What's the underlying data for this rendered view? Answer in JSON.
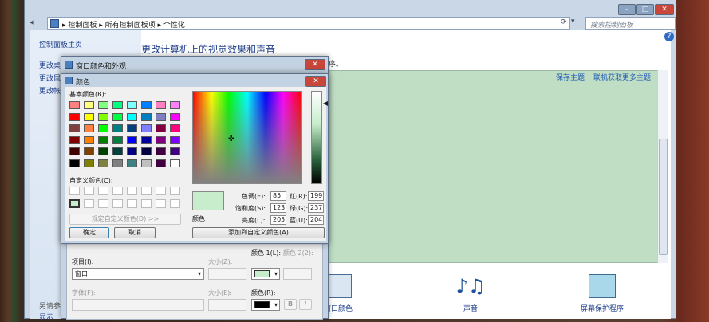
{
  "addressbar": {
    "crumbs": [
      "控制面板",
      "所有控制面板项",
      "个性化"
    ],
    "search_placeholder": "搜索控制面板"
  },
  "nav": {
    "home": "控制面板主页",
    "items": [
      "更改桌",
      "更改鼠",
      "更改帐"
    ],
    "see_also": "另请参",
    "show": "显示"
  },
  "main": {
    "title": "更改计算机上的视觉效果和声音",
    "subtitle": "序。",
    "save_theme": "保存主题",
    "online_theme": "联机获取更多主题",
    "bottom": [
      {
        "label": "窗口颜色",
        "icon": "window-color-icon"
      },
      {
        "label": "声音",
        "icon": "sound-icon"
      },
      {
        "label": "屏幕保护程序",
        "icon": "screensaver-icon"
      }
    ]
  },
  "window_color_dialog": {
    "title": "窗口颜色和外观",
    "item_label": "项目(I):",
    "item_value": "窗口",
    "size_label": "大小(Z):",
    "color1_label": "颜色 1(L):",
    "color2_label": "颜色 2(2):",
    "font_label": "字体(F):",
    "size2_label": "大小(E):",
    "color3_label": "颜色(R):",
    "bold": "B",
    "italic": "I"
  },
  "color_dialog": {
    "title": "颜色",
    "basic_label": "基本颜色(B):",
    "custom_label": "自定义颜色(C):",
    "define_button": "规定自定义颜色(D) >>",
    "ok": "确定",
    "cancel": "取消",
    "add_button": "添加到自定义颜色(A)",
    "preview_label": "颜色",
    "fields": [
      {
        "label": "色调(E):",
        "value": "85"
      },
      {
        "label": "饱和度(S):",
        "value": "123"
      },
      {
        "label": "亮度(L):",
        "value": "205"
      },
      {
        "label": "红(R):",
        "value": "199"
      },
      {
        "label": "绿(G):",
        "value": "237"
      },
      {
        "label": "蓝(U):",
        "value": "204"
      }
    ],
    "selected_color": "#c7edcc",
    "basic_colors": [
      "#ff8080",
      "#ffff80",
      "#80ff80",
      "#00ff80",
      "#80ffff",
      "#0080ff",
      "#ff80c0",
      "#ff80ff",
      "#ff0000",
      "#ffff00",
      "#80ff00",
      "#00ff40",
      "#00ffff",
      "#0080c0",
      "#8080c0",
      "#ff00ff",
      "#804040",
      "#ff8040",
      "#00ff00",
      "#008080",
      "#004080",
      "#8080ff",
      "#800040",
      "#ff0080",
      "#800000",
      "#ff8000",
      "#008000",
      "#008040",
      "#0000ff",
      "#0000a0",
      "#800080",
      "#8000ff",
      "#400000",
      "#804000",
      "#004000",
      "#004040",
      "#000080",
      "#000040",
      "#400040",
      "#400080",
      "#000000",
      "#808000",
      "#808040",
      "#808080",
      "#408080",
      "#c0c0c0",
      "#400040",
      "#ffffff"
    ]
  },
  "window_buttons": {
    "minimize": "–",
    "maximize": "□",
    "close": "✕",
    "help": "?"
  }
}
